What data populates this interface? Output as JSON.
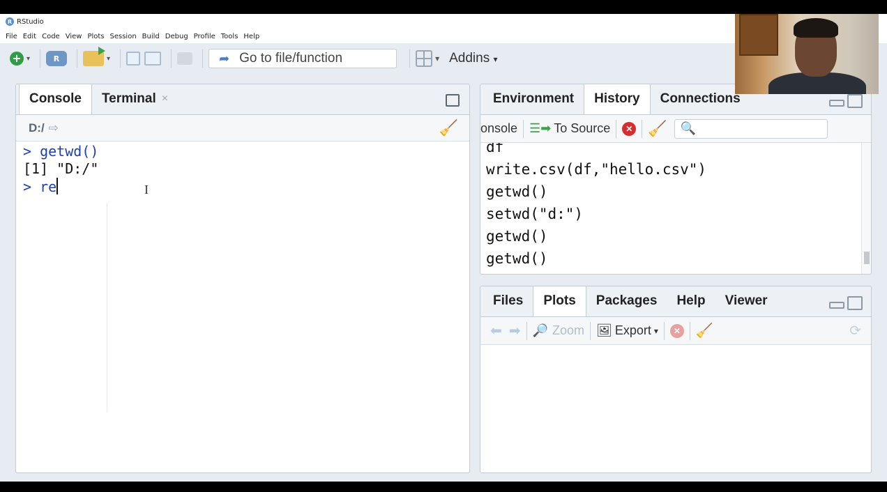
{
  "app": {
    "title": "RStudio",
    "logo_letter": "R"
  },
  "menu": [
    "File",
    "Edit",
    "Code",
    "View",
    "Plots",
    "Session",
    "Build",
    "Debug",
    "Profile",
    "Tools",
    "Help"
  ],
  "toolbar": {
    "goto_placeholder": "Go to file/function",
    "addins_label": "Addins",
    "new_project_label": "R"
  },
  "console_pane": {
    "tabs": [
      {
        "label": "Console",
        "active": true
      },
      {
        "label": "Terminal",
        "active": false,
        "close": "×"
      }
    ],
    "path": "D:/",
    "lines": [
      {
        "type": "prompt",
        "prefix": ">",
        "text": "getwd()"
      },
      {
        "type": "output",
        "text": "[1] \"D:/\""
      },
      {
        "type": "prompt",
        "prefix": ">",
        "text": "re"
      }
    ]
  },
  "env_pane": {
    "tabs": [
      {
        "label": "Environment",
        "active": false
      },
      {
        "label": "History",
        "active": true
      },
      {
        "label": "Connections",
        "active": false
      }
    ],
    "toolbar": {
      "to_console": "onsole",
      "to_source": "To Source"
    },
    "history": [
      "df",
      "write.csv(df,\"hello.csv\")",
      "getwd()",
      "setwd(\"d:\")",
      "getwd()",
      "getwd()"
    ]
  },
  "files_pane": {
    "tabs": [
      {
        "label": "Files",
        "active": false
      },
      {
        "label": "Plots",
        "active": true
      },
      {
        "label": "Packages",
        "active": false
      },
      {
        "label": "Help",
        "active": false
      },
      {
        "label": "Viewer",
        "active": false
      }
    ],
    "toolbar": {
      "zoom": "Zoom",
      "export": "Export"
    }
  },
  "colors": {
    "prompt": "#1d3fb4",
    "accent": "#4a7fc2",
    "bg": "#e7ecf2"
  }
}
